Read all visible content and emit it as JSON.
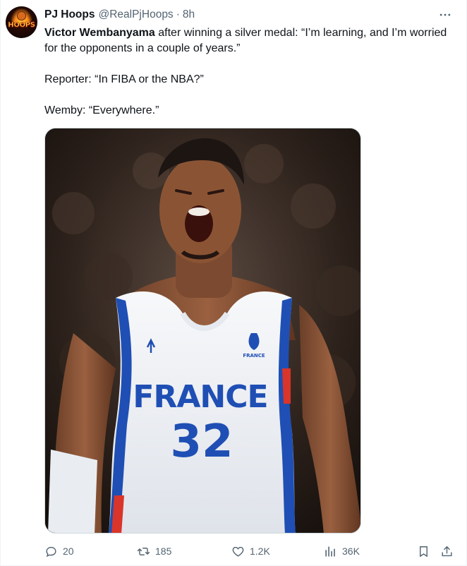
{
  "author": {
    "display_name": "PJ Hoops",
    "handle": "@RealPjHoops",
    "separator": "·",
    "time": "8h",
    "avatar_text": "HOOPS"
  },
  "more_icon": "more-horizontal-icon",
  "tweet": {
    "line1_bold": "Victor Wembanyama",
    "line1_rest": " after winning a silver medal: “I’m learning, and I’m worried for the opponents in a couple of years.”",
    "line2": "Reporter: “In FIBA or the NBA?”",
    "line3": "Wemby: “Everywhere.”"
  },
  "media": {
    "jersey_text": "FRANCE",
    "jersey_number": "32",
    "badge_text": "FRANCE"
  },
  "actions": {
    "reply_count": "20",
    "retweet_count": "185",
    "like_count": "1.2K",
    "views_count": "36K"
  },
  "colors": {
    "text_primary": "#0f1419",
    "text_secondary": "#536471",
    "jersey_blue": "#1f4fb4",
    "jersey_red": "#d9352a"
  }
}
